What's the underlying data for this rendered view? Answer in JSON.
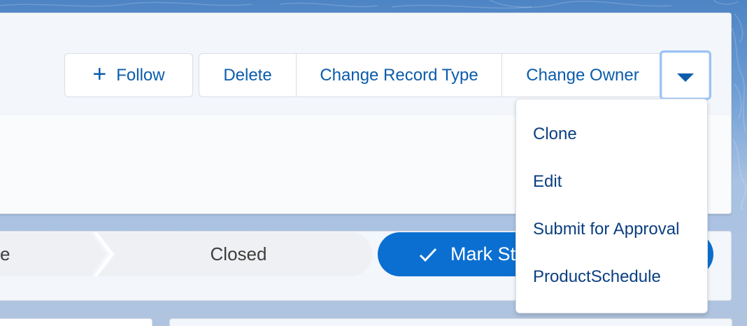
{
  "header": {
    "follow_label": "Follow",
    "follow_icon": "plus-icon",
    "actions": {
      "delete_label": "Delete",
      "change_record_type_label": "Change Record Type",
      "change_owner_label": "Change Owner",
      "more_icon": "chevron-down-icon"
    }
  },
  "dropdown_menu": {
    "items": [
      {
        "label": "Clone"
      },
      {
        "label": "Edit"
      },
      {
        "label": "Submit for Approval"
      },
      {
        "label": "ProductSchedule"
      }
    ]
  },
  "path": {
    "previous_stage_label": "e",
    "closed_stage_label": "Closed",
    "mark_button_label": "Mark St",
    "mark_icon": "check-icon"
  },
  "colors": {
    "brand_blue": "#0b6fd1",
    "link_blue": "#0b5cab",
    "menu_text": "#0b3f80",
    "focus_ring": "#9cc3f4"
  }
}
